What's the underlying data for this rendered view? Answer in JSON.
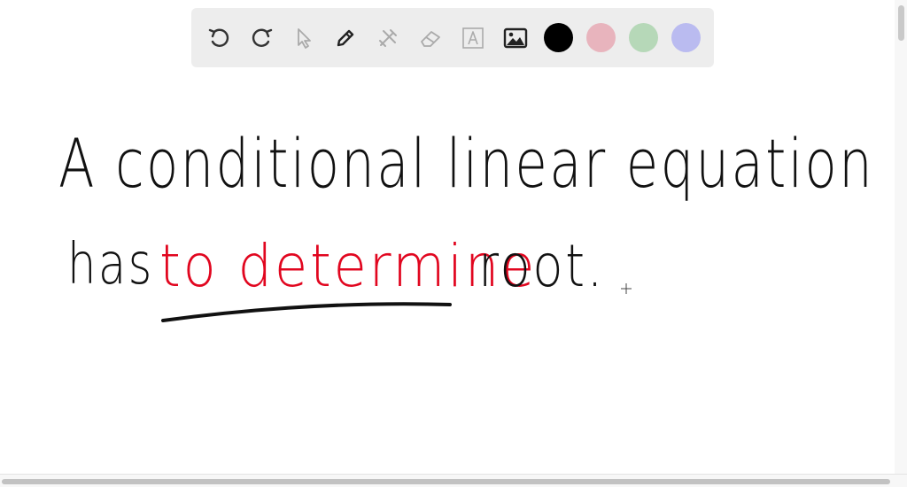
{
  "toolbar": {
    "tools": [
      {
        "name": "undo-icon",
        "enabled": true
      },
      {
        "name": "redo-icon",
        "enabled": true
      },
      {
        "name": "select-pointer-icon",
        "enabled": false
      },
      {
        "name": "pen-icon",
        "enabled": true
      },
      {
        "name": "tools-icon",
        "enabled": false
      },
      {
        "name": "eraser-icon",
        "enabled": false
      },
      {
        "name": "text-icon",
        "enabled": false
      },
      {
        "name": "image-icon",
        "enabled": true
      }
    ],
    "colors": {
      "black": "#000000",
      "pink": "#e8b4bd",
      "green": "#b6d8b8",
      "lavender": "#babbf0"
    }
  },
  "board": {
    "line1": "A conditional linear equation",
    "line2_start": "has",
    "line2_highlight": "to determine",
    "line2_end": "root.",
    "ink_color": "#111111",
    "highlight_color": "#e1061f"
  }
}
